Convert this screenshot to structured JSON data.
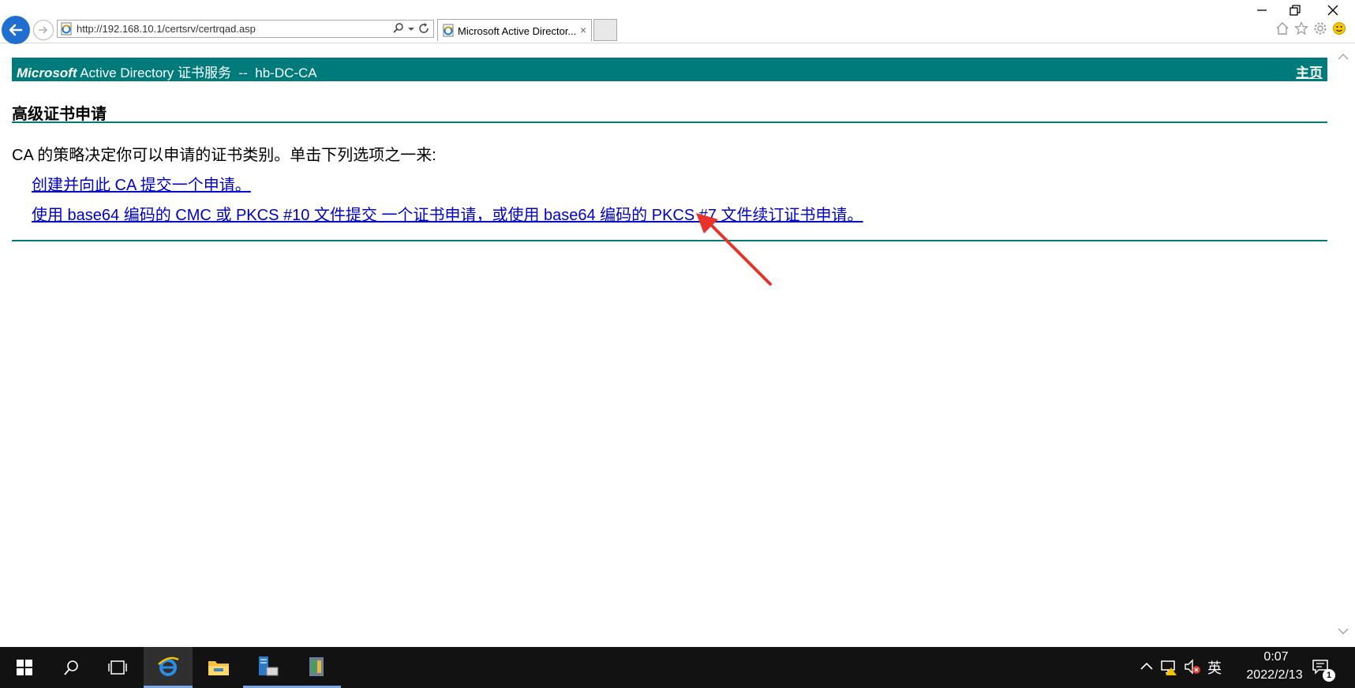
{
  "browser": {
    "address_url": "http://192.168.10.1/certsrv/certrqad.asp",
    "tab_title": "Microsoft Active Director...",
    "tab_close_glyph": "×"
  },
  "page": {
    "banner": {
      "brand": "Microsoft",
      "title": " Active Directory 证书服务  --  hb-DC-CA",
      "home_link": "主页"
    },
    "heading": "高级证书申请",
    "intro": "CA 的策略决定你可以申请的证书类别。单击下列选项之一来:",
    "options": [
      "创建并向此 CA 提交一个申请。",
      "使用 base64 编码的 CMC 或 PKCS #10 文件提交 一个证书申请，或使用 base64 编码的 PKCS #7 文件续订证书申请。"
    ]
  },
  "taskbar": {
    "ime": "英",
    "time": "0:07",
    "date": "2022/2/13",
    "notifications_count": "1"
  },
  "icons": {
    "back": "back-arrow-icon",
    "forward": "forward-arrow-icon",
    "favicon": "ie-page-icon",
    "search": "search-icon",
    "refresh": "refresh-icon",
    "minimize": "minimize-icon",
    "restore": "restore-icon",
    "close": "close-icon",
    "home": "home-icon",
    "favorites": "star-icon",
    "tools": "gear-icon",
    "feedback": "smiley-icon"
  },
  "colors": {
    "banner_bg": "#007b7b",
    "link": "#0000cc",
    "back_button": "#1e6fd0",
    "taskbar_bg": "#121212",
    "annotation_arrow": "#e8332a"
  }
}
